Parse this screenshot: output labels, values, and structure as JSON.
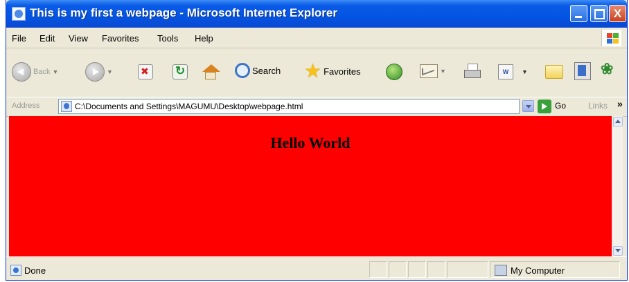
{
  "window": {
    "title": "This is my first a webpage - Microsoft Internet Explorer",
    "close_glyph": "X"
  },
  "menu": [
    "File",
    "Edit",
    "View",
    "Favorites",
    "Tools",
    "Help"
  ],
  "toolbar": {
    "back_label": "Back",
    "search_label": "Search",
    "favorites_label": "Favorites"
  },
  "address": {
    "label": "Address",
    "value": "C:\\Documents and Settings\\MAGUMU\\Desktop\\webpage.html",
    "go_label": "Go",
    "links_label": "Links",
    "more_glyph": "»"
  },
  "content": {
    "heading": "Hello World",
    "background": "#ff0000"
  },
  "status": {
    "text": "Done",
    "zone": "My Computer"
  },
  "colors": {
    "titlebar": "#0454e3",
    "chrome": "#ece9d8"
  }
}
